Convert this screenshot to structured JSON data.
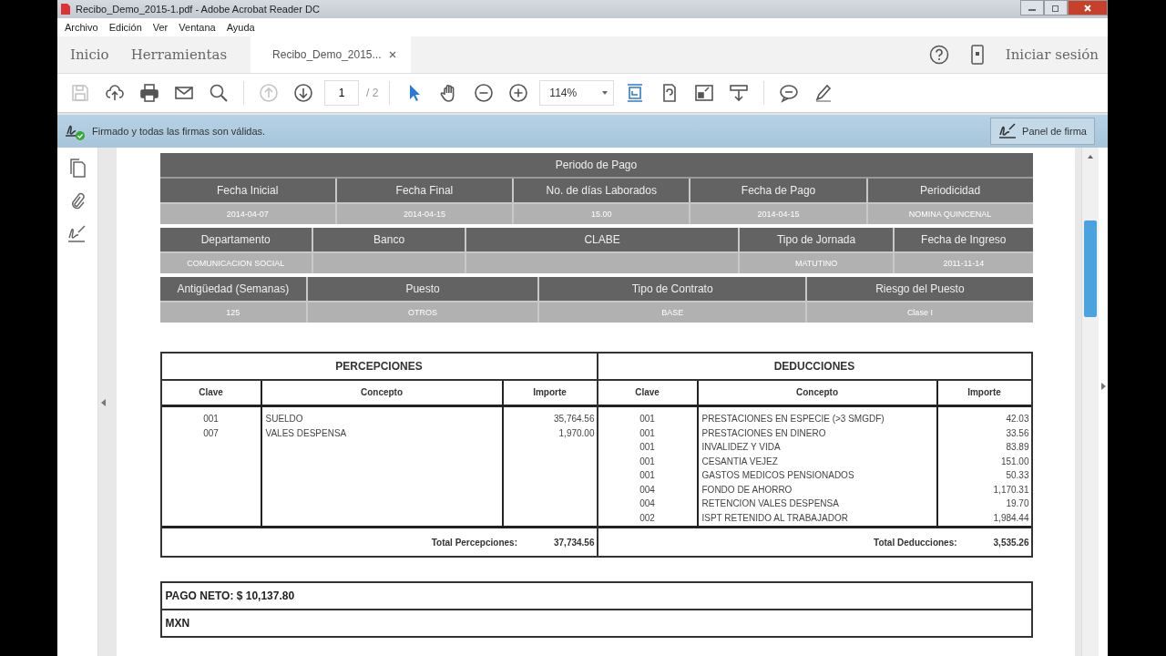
{
  "window": {
    "title": "Recibo_Demo_2015-1.pdf - Adobe Acrobat Reader DC"
  },
  "menu": [
    "Archivo",
    "Edición",
    "Ver",
    "Ventana",
    "Ayuda"
  ],
  "tabs": [
    {
      "label": "Inicio",
      "selected": false
    },
    {
      "label": "Herramientas",
      "selected": false
    },
    {
      "label": "Recibo_Demo_2015...",
      "selected": true
    }
  ],
  "account": {
    "label": "Iniciar sesión"
  },
  "toolbar": [
    [
      {
        "kind": "save",
        "disabled": true,
        "selected": false
      },
      {
        "kind": "upload",
        "disabled": false,
        "selected": false
      },
      {
        "kind": "print",
        "disabled": false,
        "selected": false
      },
      {
        "kind": "mail",
        "disabled": false,
        "selected": false
      },
      {
        "kind": "search",
        "disabled": false,
        "selected": false
      }
    ],
    [
      {
        "kind": "prev",
        "disabled": true,
        "selected": false
      },
      {
        "kind": "next",
        "disabled": false,
        "selected": false
      }
    ],
    [
      {
        "kind": "select",
        "disabled": false,
        "selected": true
      },
      {
        "kind": "hand",
        "disabled": false,
        "selected": false
      },
      {
        "kind": "zoomout",
        "disabled": false,
        "selected": false
      },
      {
        "kind": "zoomin",
        "disabled": false,
        "selected": false
      }
    ],
    [
      {
        "kind": "fit",
        "disabled": false,
        "selected": true
      },
      {
        "kind": "rotate",
        "disabled": false,
        "selected": false
      },
      {
        "kind": "fullscreen",
        "disabled": false,
        "selected": false
      },
      {
        "kind": "scroll",
        "disabled": false,
        "selected": false
      }
    ],
    [
      {
        "kind": "comment",
        "disabled": false,
        "selected": false
      },
      {
        "kind": "pen",
        "disabled": false,
        "selected": false
      }
    ]
  ],
  "page_field": {
    "value": "1",
    "total": "/ 2"
  },
  "zoom_field": {
    "value": "114%"
  },
  "signature_bar": {
    "message": "Firmado y todas las firmas son válidas.",
    "button": "Panel de firma"
  },
  "info_tables": [
    {
      "title": "Periodo de Pago",
      "cells": [
        {
          "header": "Fecha Inicial",
          "value": "2014-04-07"
        },
        {
          "header": "Fecha Final",
          "value": "2014-04-15"
        },
        {
          "header": "No. de días Laborados",
          "value": "15.00"
        },
        {
          "header": "Fecha de Pago",
          "value": "2014-04-15"
        },
        {
          "header": "Periodicidad",
          "value": "NOMINA QUINCENAL"
        }
      ]
    },
    {
      "cells": [
        {
          "header": "Departamento",
          "value": "COMUNICACION SOCIAL"
        },
        {
          "header": "Banco"
        },
        {
          "header": "CLABE"
        },
        {
          "header": "Tipo de Jornada",
          "value": "MATUTINO"
        },
        {
          "header": "Fecha de Ingreso",
          "value": "2011-11-14"
        }
      ]
    },
    {
      "cells": [
        {
          "header": "Antigüedad (Semanas)",
          "value": "125"
        },
        {
          "header": "Puesto",
          "value": "OTROS"
        },
        {
          "header": "Tipo de Contrato",
          "value": "BASE"
        },
        {
          "header": "Riesgo del Puesto",
          "value": "Clase I"
        }
      ]
    }
  ],
  "sections": [
    {
      "title": "PERCEPCIONES",
      "columns": [
        "Clave",
        "Concepto",
        "Importe"
      ],
      "rows": [
        [
          "001",
          "SUELDO",
          "35,764.56"
        ],
        [
          "007",
          "VALES DESPENSA",
          "1,970.00"
        ]
      ],
      "total_label": "Total Percepciones:",
      "total": "37,734.56"
    },
    {
      "title": "DEDUCCIONES",
      "columns": [
        "Clave",
        "Concepto",
        "Importe"
      ],
      "rows": [
        [
          "001",
          "PRESTACIONES EN ESPECIE (>3 SMGDF)",
          "42.03"
        ],
        [
          "001",
          "PRESTACIONES EN DINERO",
          "33.56"
        ],
        [
          "001",
          "INVALIDEZ Y VIDA",
          "83.89"
        ],
        [
          "001",
          "CESANTIA VEJEZ",
          "151.00"
        ],
        [
          "001",
          "GASTOS MEDICOS PENSIONADOS",
          "50.33"
        ],
        [
          "004",
          "FONDO DE AHORRO",
          "1,170.31"
        ],
        [
          "004",
          "RETENCION VALES DESPENSA",
          "19.70"
        ],
        [
          "002",
          "ISPT RETENIDO AL TRABAJADOR",
          "1,984.44"
        ]
      ],
      "total_label": "Total Deducciones:",
      "total": "3,535.26"
    }
  ],
  "net_pay": {
    "label": "PAGO NETO: $ 10,137.80",
    "currency": "MXN"
  }
}
